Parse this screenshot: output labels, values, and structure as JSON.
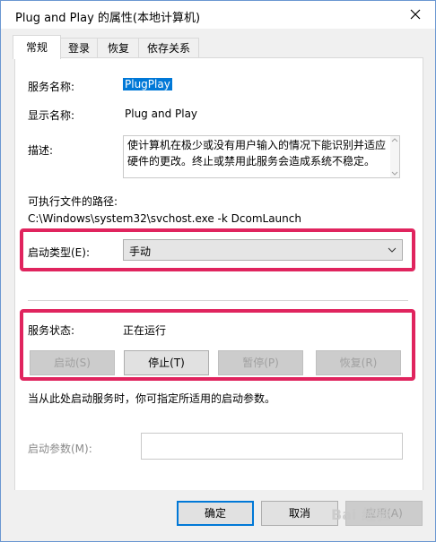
{
  "window": {
    "title": "Plug and Play 的属性(本地计算机)"
  },
  "tabs": [
    {
      "label": "常规"
    },
    {
      "label": "登录"
    },
    {
      "label": "恢复"
    },
    {
      "label": "依存关系"
    }
  ],
  "general": {
    "service_name_label": "服务名称:",
    "service_name_value": "PlugPlay",
    "display_name_label": "显示名称:",
    "display_name_value": "Plug and Play",
    "description_label": "描述:",
    "description_value": "使计算机在极少或没有用户输入的情况下能识别并适应硬件的更改。终止或禁用此服务会造成系统不稳定。",
    "path_label": "可执行文件的路径:",
    "path_value": "C:\\Windows\\system32\\svchost.exe -k DcomLaunch",
    "startup_type_label": "启动类型(E):",
    "startup_type_value": "手动",
    "status_label": "服务状态:",
    "status_value": "正在运行",
    "buttons": {
      "start": "启动(S)",
      "stop": "停止(T)",
      "pause": "暂停(P)",
      "resume": "恢复(R)"
    },
    "hint_text": "当从此处启动服务时，你可指定所适用的启动参数。",
    "start_params_label": "启动参数(M):",
    "start_params_value": ""
  },
  "footer": {
    "ok": "确定",
    "cancel": "取消",
    "apply": "应用(A)"
  },
  "colors": {
    "accent": "#0078d7",
    "highlight_box": "#e0245e"
  }
}
